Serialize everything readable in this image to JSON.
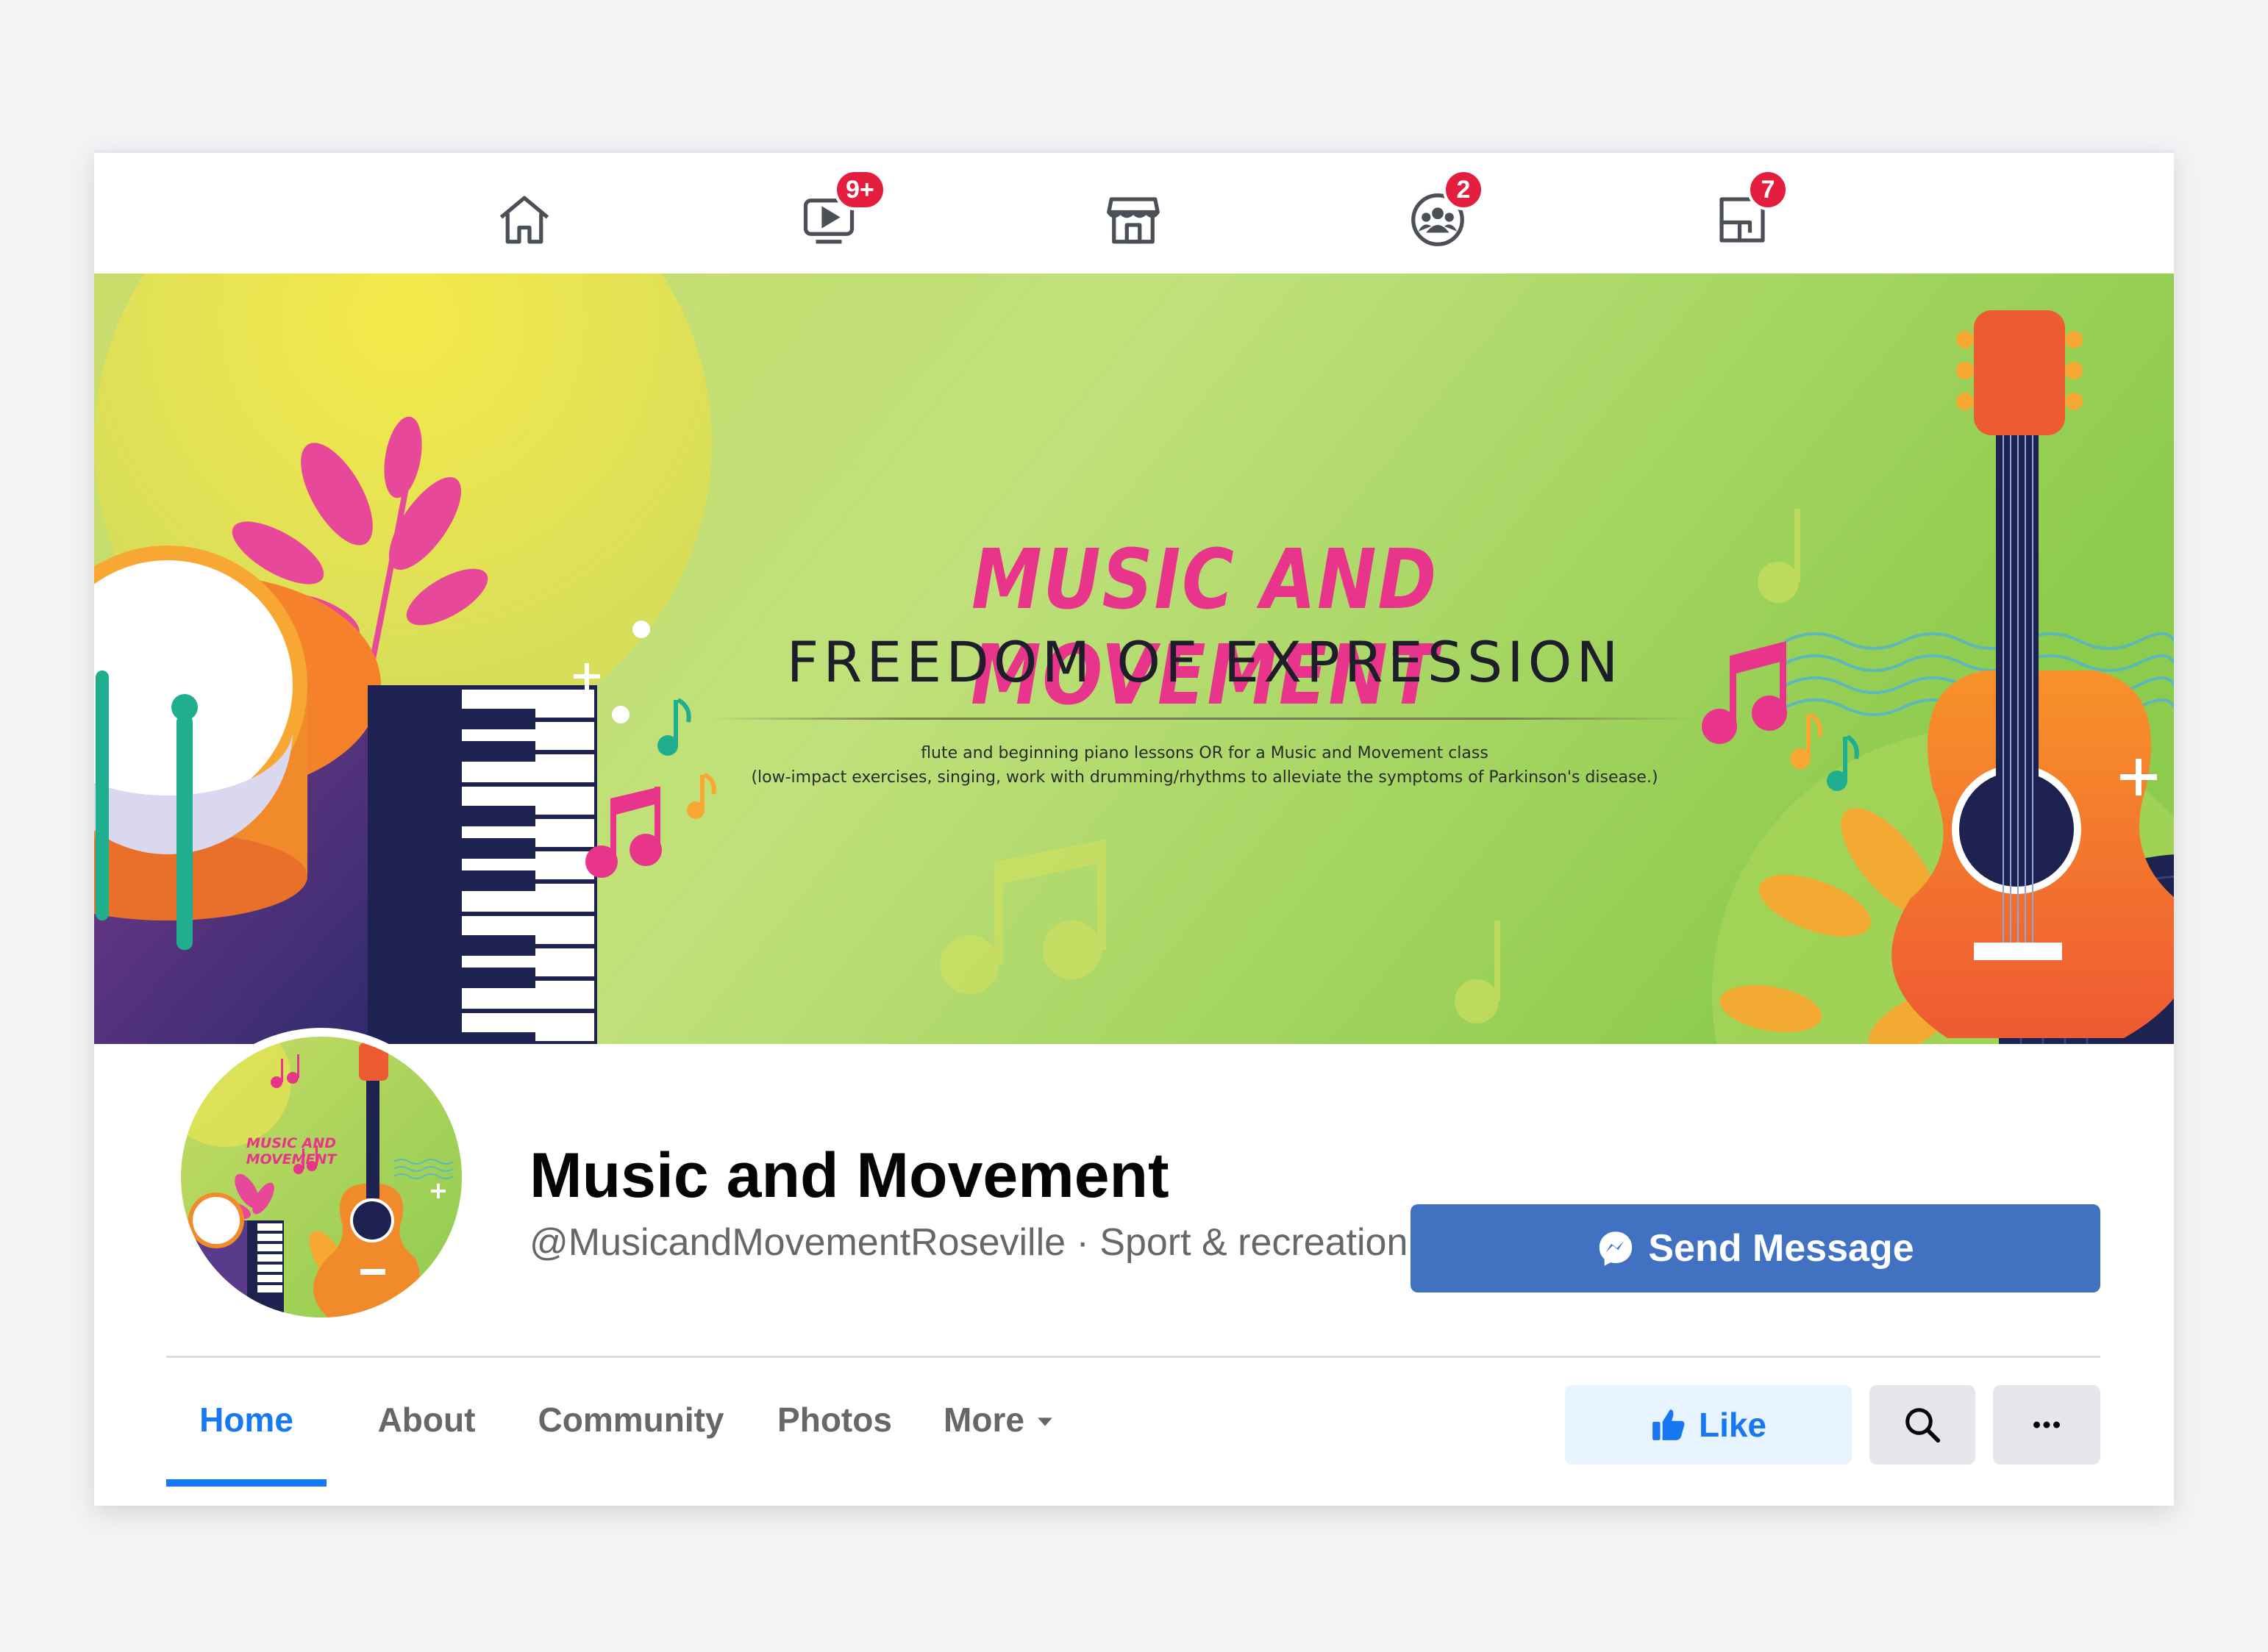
{
  "topnav": {
    "icons": [
      {
        "name": "home-icon",
        "badge": ""
      },
      {
        "name": "watch-icon",
        "badge": "9+"
      },
      {
        "name": "marketplace-icon",
        "badge": ""
      },
      {
        "name": "groups-icon",
        "badge": "2"
      },
      {
        "name": "gaming-icon",
        "badge": "7"
      }
    ]
  },
  "cover": {
    "title": "MUSIC AND MOVEMENT",
    "subtitle": "FREEDOM OF EXPRESSION",
    "desc_line1": "flute and beginning piano lessons OR for a Music and Movement class",
    "desc_line2": "(low-impact exercises, singing, work with drumming/rhythms to alleviate the symptoms of Parkinson's disease.)"
  },
  "avatar": {
    "logo_text": "MUSIC AND MOVEMENT"
  },
  "page": {
    "name": "Music and Movement",
    "handle": "@MusicandMovementRoseville · Sport & recreation"
  },
  "actions": {
    "send_message": "Send Message",
    "like": "Like"
  },
  "tabs": [
    {
      "label": "Home",
      "active": true
    },
    {
      "label": "About",
      "active": false
    },
    {
      "label": "Community",
      "active": false
    },
    {
      "label": "Photos",
      "active": false
    },
    {
      "label": "More",
      "active": false
    }
  ],
  "colors": {
    "accent": "#1877f2",
    "send_button": "#4172c2",
    "badge": "#e41e3f",
    "title_pink": "#e8348a"
  }
}
